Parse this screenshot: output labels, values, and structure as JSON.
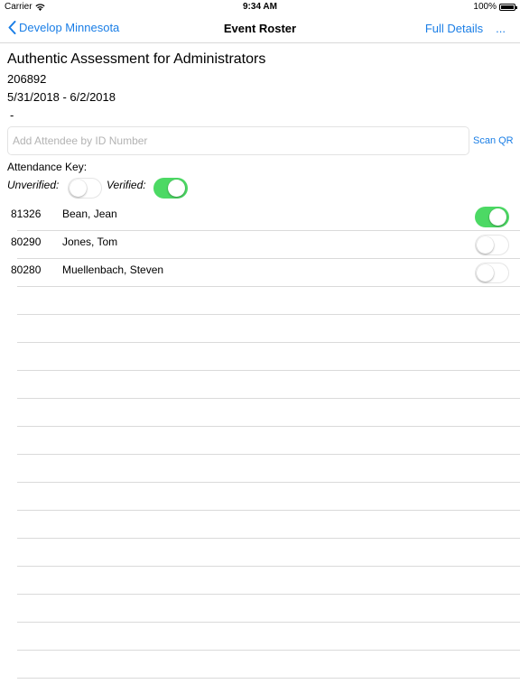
{
  "status_bar": {
    "carrier": "Carrier",
    "time": "9:34 AM",
    "battery": "100%"
  },
  "nav": {
    "back_label": "Develop Minnesota",
    "title": "Event Roster",
    "full_details_label": "Full Details",
    "more_label": "..."
  },
  "event": {
    "title": "Authentic Assessment for Administrators",
    "id": "206892",
    "dates": "5/31/2018 - 6/2/2018",
    "location": "-"
  },
  "add_attendee": {
    "placeholder": "Add Attendee by ID Number",
    "value": "",
    "scan_label": "Scan QR"
  },
  "attendance_key": {
    "label": "Attendance Key:",
    "unverified_label": "Unverified:",
    "verified_label": "Verified:"
  },
  "attendees": [
    {
      "id": "81326",
      "name": "Bean, Jean",
      "verified": true
    },
    {
      "id": "80290",
      "name": "Jones, Tom",
      "verified": false
    },
    {
      "id": "80280",
      "name": "Muellenbach, Steven",
      "verified": false
    }
  ],
  "colors": {
    "accent": "#1a7ee6",
    "switch_on": "#4cd964",
    "separator": "#dadada"
  }
}
